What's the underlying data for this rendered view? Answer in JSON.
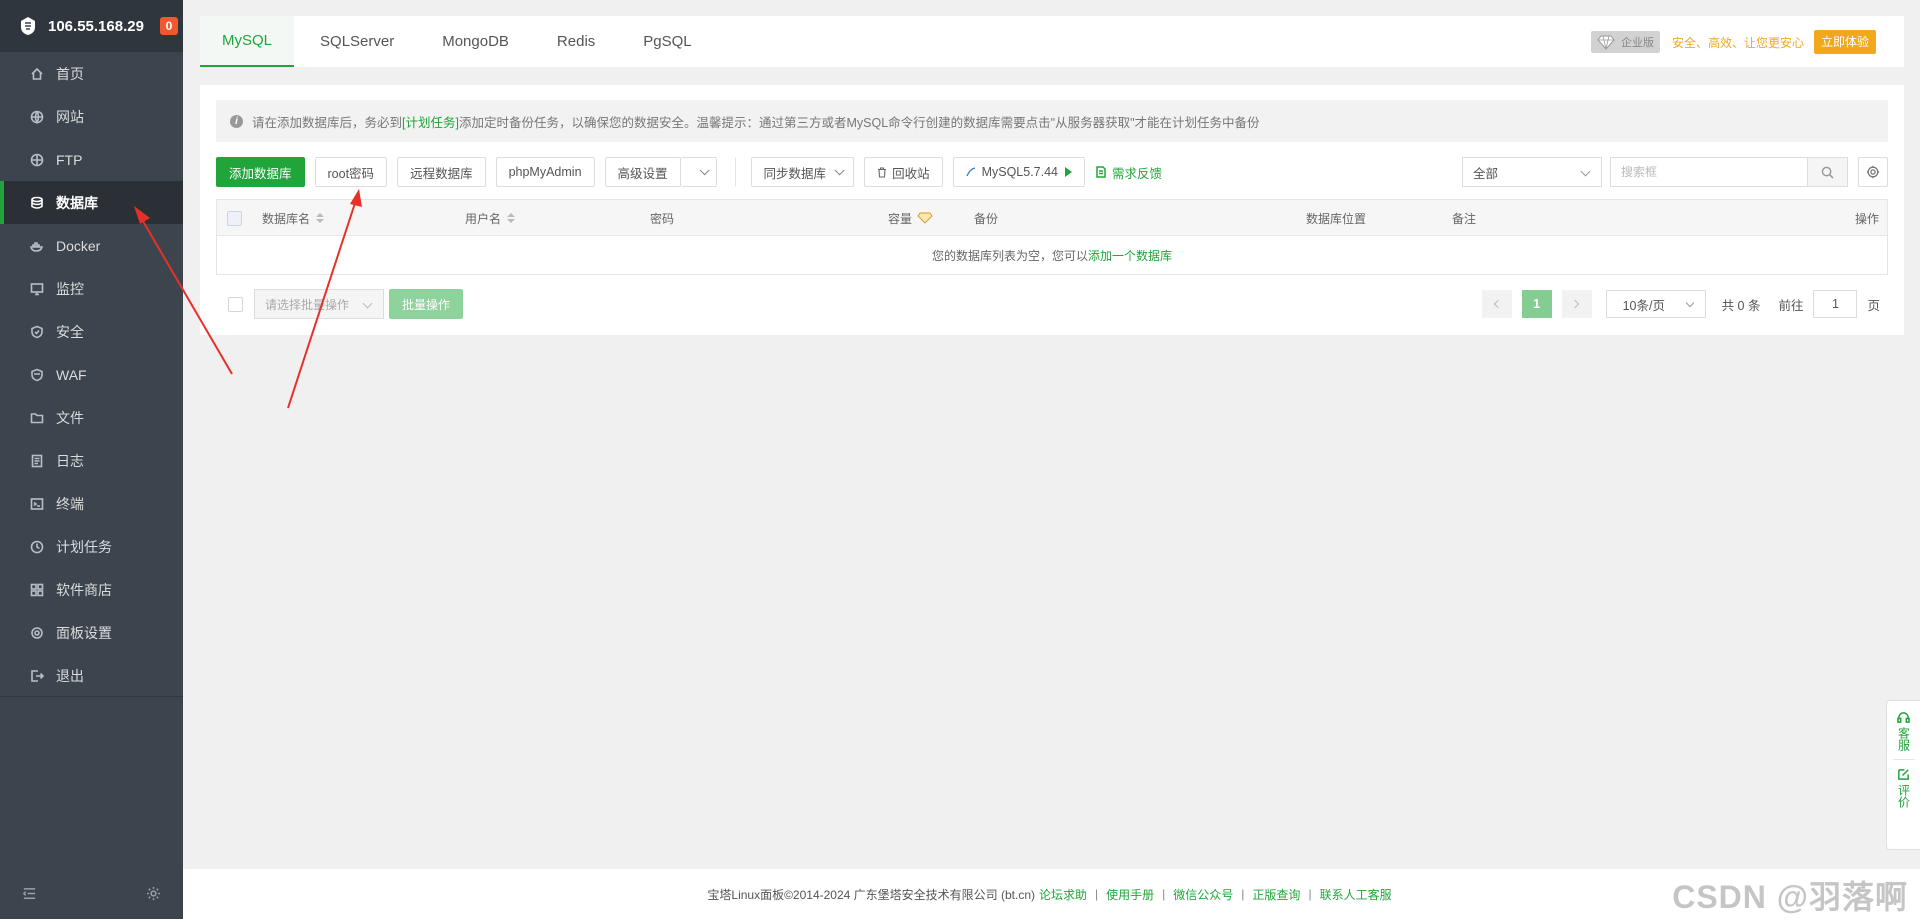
{
  "sidebar": {
    "server_ip": "106.55.168.29",
    "badge_count": "0",
    "items": [
      {
        "label": "首页",
        "icon": "home-icon"
      },
      {
        "label": "网站",
        "icon": "globe-icon"
      },
      {
        "label": "FTP",
        "icon": "ftp-icon"
      },
      {
        "label": "数据库",
        "icon": "database-icon"
      },
      {
        "label": "Docker",
        "icon": "docker-icon"
      },
      {
        "label": "监控",
        "icon": "monitor-icon"
      },
      {
        "label": "安全",
        "icon": "shield-icon"
      },
      {
        "label": "WAF",
        "icon": "waf-icon"
      },
      {
        "label": "文件",
        "icon": "folder-icon"
      },
      {
        "label": "日志",
        "icon": "log-icon"
      },
      {
        "label": "终端",
        "icon": "terminal-icon"
      },
      {
        "label": "计划任务",
        "icon": "clock-icon"
      },
      {
        "label": "软件商店",
        "icon": "apps-icon"
      },
      {
        "label": "面板设置",
        "icon": "settings-icon"
      },
      {
        "label": "退出",
        "icon": "logout-icon"
      }
    ],
    "active_index": 3
  },
  "tabs": [
    "MySQL",
    "SQLServer",
    "MongoDB",
    "Redis",
    "PgSQL"
  ],
  "promo": {
    "enterprise_label": "企业版",
    "slogan": "安全、高效、让您更安心",
    "cta": "立即体验"
  },
  "notice": {
    "prefix": "请在添加数据库后，务必到",
    "link": "[计划任务]",
    "suffix": "添加定时备份任务，以确保您的数据安全。温馨提示：通过第三方或者MySQL命令行创建的数据库需要点击\"从服务器获取\"才能在计划任务中备份"
  },
  "toolbar": {
    "add_db": "添加数据库",
    "root_pwd": "root密码",
    "remote_db": "远程数据库",
    "phpmyadmin": "phpMyAdmin",
    "advanced": "高级设置",
    "sync_db": "同步数据库",
    "recycle": "回收站",
    "mysql_version": "MySQL5.7.44",
    "feedback": "需求反馈",
    "filter_value": "全部",
    "search_placeholder": "搜索框"
  },
  "table": {
    "headers": {
      "name": "数据库名",
      "user": "用户名",
      "password": "密码",
      "capacity": "容量",
      "backup": "备份",
      "location": "数据库位置",
      "remark": "备注",
      "action": "操作"
    },
    "empty_prefix": "您的数据库列表为空，您可以",
    "empty_link": "添加一个数据库"
  },
  "bottom": {
    "batch_placeholder": "请选择批量操作",
    "batch_button": "批量操作",
    "current_page": "1",
    "page_size": "10条/页",
    "total": "共 0 条",
    "goto_label": "前往",
    "goto_value": "1",
    "goto_unit": "页"
  },
  "footer": {
    "copyright": "宝塔Linux面板©2014-2024 广东堡塔安全技术有限公司 (bt.cn)",
    "links": [
      "论坛求助",
      "使用手册",
      "微信公众号",
      "正版查询",
      "联系人工客服"
    ]
  },
  "float_widget": {
    "support": "客服",
    "review": "评价"
  },
  "watermark": "CSDN @羽落啊",
  "colors": {
    "brand_green": "#20a53a",
    "sidebar_bg": "#3c444d",
    "promo_orange": "#f2a81d",
    "badge_orange": "#f0582d",
    "annotation_red": "#e8302a"
  }
}
